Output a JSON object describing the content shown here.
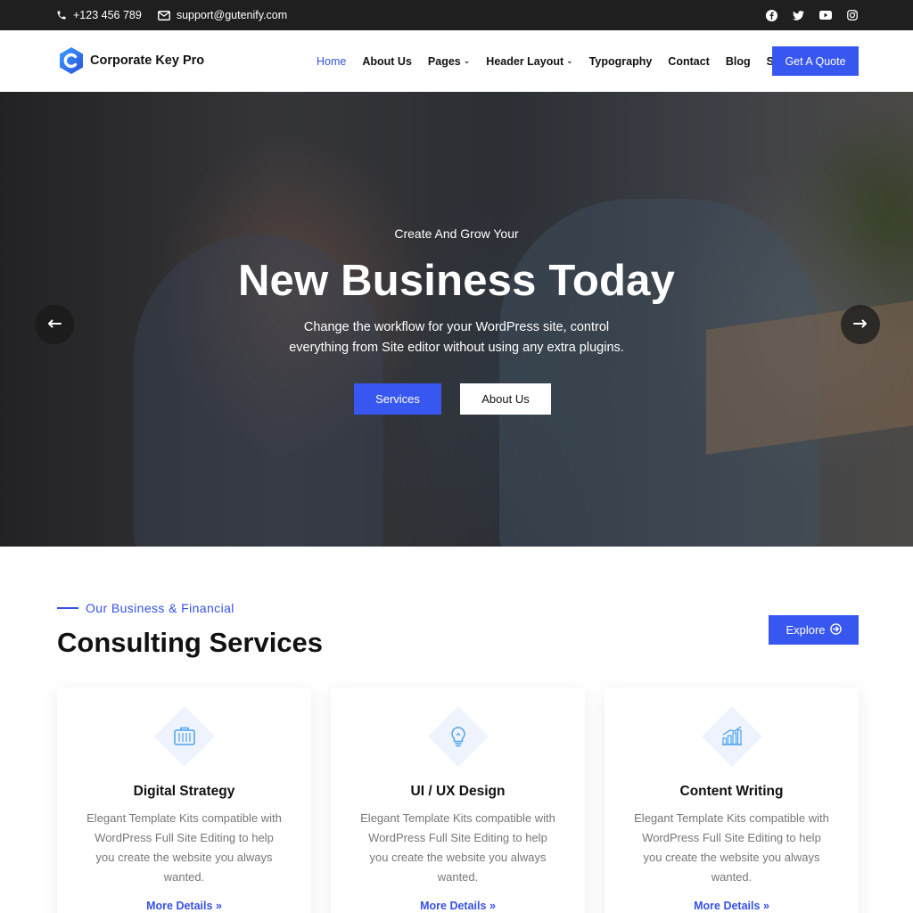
{
  "topbar": {
    "phone": "+123 456 789",
    "email": "support@gutenify.com",
    "social": [
      "facebook-icon",
      "twitter-icon",
      "youtube-icon",
      "instagram-icon"
    ]
  },
  "header": {
    "logo_text": "Corporate Key Pro",
    "nav": [
      {
        "label": "Home",
        "active": true
      },
      {
        "label": "About Us"
      },
      {
        "label": "Pages",
        "dropdown": true
      },
      {
        "label": "Header Layout",
        "dropdown": true
      },
      {
        "label": "Typography"
      },
      {
        "label": "Contact"
      },
      {
        "label": "Blog"
      },
      {
        "label": "Shop"
      }
    ],
    "cta": "Get A Quote"
  },
  "hero": {
    "overline": "Create And Grow Your",
    "headline": "New Business Today",
    "description_line1": "Change the workflow for your WordPress site, control",
    "description_line2": "everything from Site editor without using any extra plugins.",
    "primary_button": "Services",
    "secondary_button": "About Us"
  },
  "services": {
    "eyebrow": "Our Business & Financial",
    "title": "Consulting Services",
    "explore": "Explore",
    "cards": [
      {
        "icon": "briefcase-icon",
        "title": "Digital Strategy",
        "text": "Elegant Template Kits compatible with WordPress Full Site Editing to help you create the website you always wanted.",
        "link": "More Details"
      },
      {
        "icon": "lightbulb-icon",
        "title": "UI / UX Design",
        "text": "Elegant Template Kits compatible with WordPress Full Site Editing to help you create the website you always wanted.",
        "link": "More Details"
      },
      {
        "icon": "growth-chart-icon",
        "title": "Content Writing",
        "text": "Elegant Template Kits compatible with WordPress Full Site Editing to help you create the website you always wanted.",
        "link": "More Details"
      }
    ]
  },
  "colors": {
    "accent": "#3856f0",
    "topbar_bg": "#1f1f1f",
    "icon_blue": "#4aa3f0"
  }
}
